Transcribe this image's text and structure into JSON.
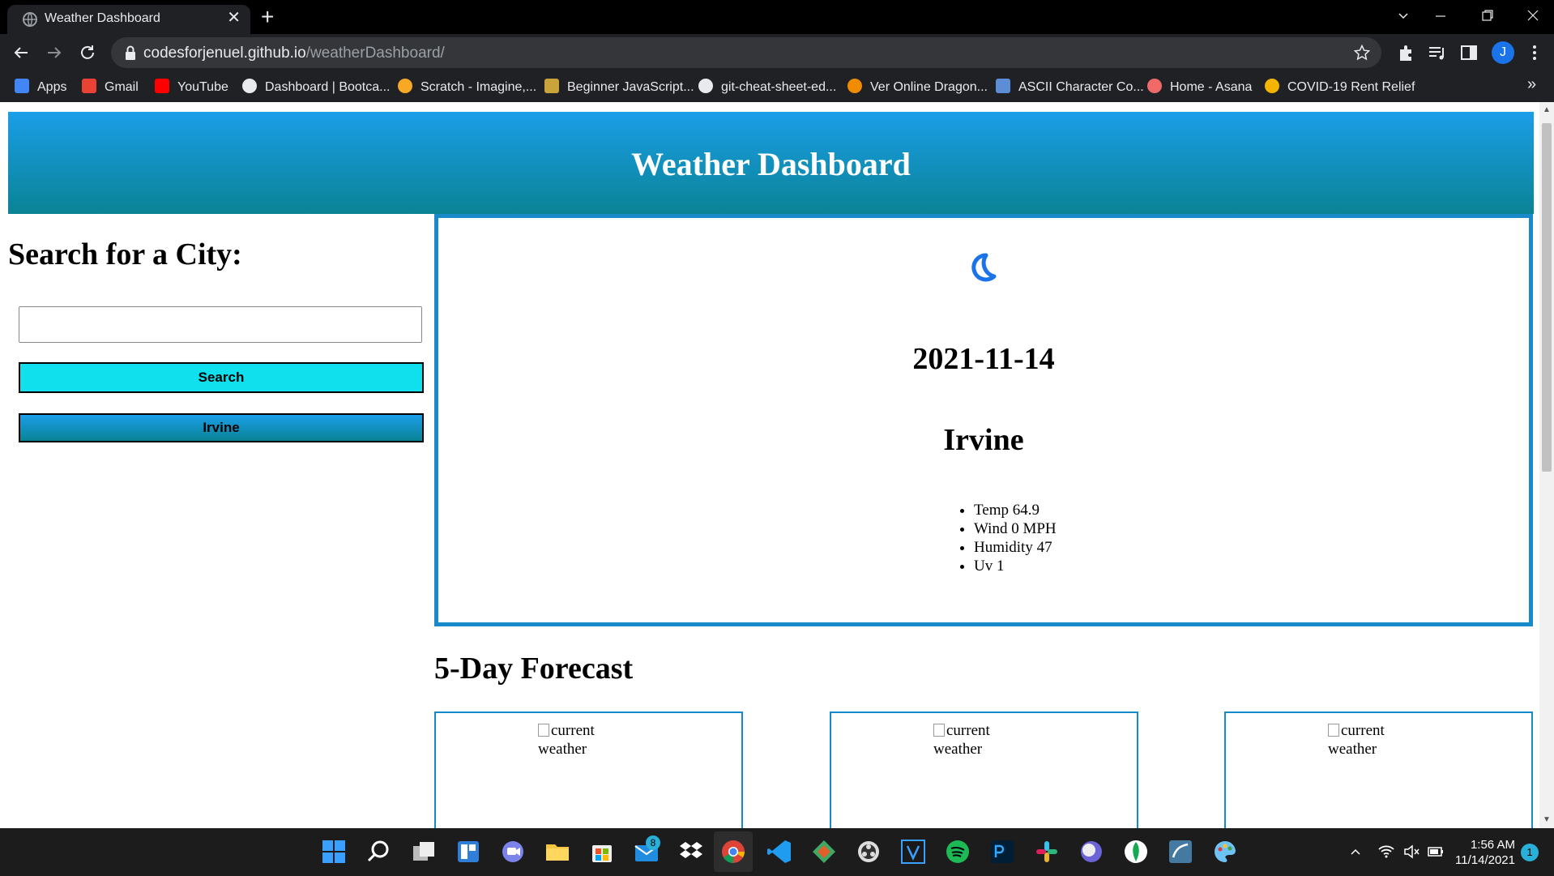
{
  "browser": {
    "tab_title": "Weather Dashboard",
    "tab_close": "✕",
    "new_tab": "+",
    "url_host": "codesforjenuel.github.io",
    "url_path": "/weatherDashboard/",
    "profile_initial": "J",
    "bookmarks": [
      {
        "label": "Apps",
        "icon": "apps-grid-icon",
        "color": "#4285f4"
      },
      {
        "label": "Gmail",
        "icon": "gmail-icon",
        "color": "#ea4335"
      },
      {
        "label": "YouTube",
        "icon": "youtube-icon",
        "color": "#ff0000"
      },
      {
        "label": "Dashboard | Bootca...",
        "icon": "globe-icon",
        "color": "#e8eaed"
      },
      {
        "label": "Scratch - Imagine,...",
        "icon": "scratch-icon",
        "color": "#f9a825"
      },
      {
        "label": "Beginner JavaScript...",
        "icon": "crown-icon",
        "color": "#caa33a"
      },
      {
        "label": "git-cheat-sheet-ed...",
        "icon": "github-icon",
        "color": "#e8eaed"
      },
      {
        "label": "Ver Online Dragon...",
        "icon": "dragonball-icon",
        "color": "#f08c00"
      },
      {
        "label": "ASCII Character Co...",
        "icon": "ascii-icon",
        "color": "#5b8ed6"
      },
      {
        "label": "Home - Asana",
        "icon": "asana-icon",
        "color": "#f06a6a"
      },
      {
        "label": "COVID-19 Rent Relief",
        "icon": "rent-relief-icon",
        "color": "#f4b400"
      }
    ],
    "more_bookmarks": "»"
  },
  "page": {
    "header_title": "Weather Dashboard",
    "search_heading": "Search for a City:",
    "search_value": "",
    "search_button": "Search",
    "history": [
      "Irvine"
    ],
    "current": {
      "icon": "moon-icon",
      "date": "2021-11-14",
      "city": "Irvine",
      "stats": [
        "Temp 64.9",
        "Wind 0 MPH",
        "Humidity 47",
        "Uv 1"
      ]
    },
    "forecast_heading": "5-Day Forecast",
    "forecast_cards": [
      {
        "alt": "current weather"
      },
      {
        "alt": "current weather"
      },
      {
        "alt": "current weather"
      }
    ]
  },
  "taskbar": {
    "mail_badge": "8",
    "time": "1:56 AM",
    "date": "11/14/2021",
    "notifications": "1"
  },
  "colors": {
    "header_gradient_top": "#1a9ee8",
    "header_gradient_bottom": "#0a8395",
    "search_button": "#10e0ee",
    "card_border": "#1889c9"
  }
}
